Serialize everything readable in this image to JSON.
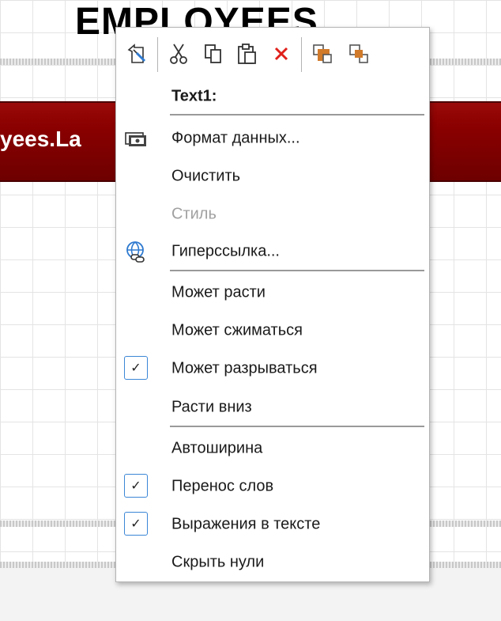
{
  "canvas": {
    "title": "EMPLOYEES",
    "header_field": "yees.La"
  },
  "toolbar": {
    "buttons": [
      {
        "name": "edit-icon"
      },
      {
        "name": "cut-icon"
      },
      {
        "name": "copy-icon"
      },
      {
        "name": "paste-icon"
      },
      {
        "name": "delete-icon",
        "color": "#e0201b"
      },
      {
        "name": "bring-to-front-icon",
        "color": "#d07a2a"
      },
      {
        "name": "send-to-back-icon",
        "color": "#d07a2a"
      }
    ]
  },
  "menu": {
    "header": "Text1:",
    "items": [
      {
        "label": "Формат данных...",
        "icon": "data-format-icon",
        "enabled": true
      },
      {
        "label": "Очистить",
        "enabled": true
      },
      {
        "label": "Стиль",
        "enabled": false
      },
      {
        "label": "Гиперссылка...",
        "icon": "hyperlink-icon",
        "enabled": true
      },
      {
        "label": "Может расти",
        "enabled": true
      },
      {
        "label": "Может сжиматься",
        "enabled": true
      },
      {
        "label": "Может разрываться",
        "checked": true
      },
      {
        "label": "Расти вниз",
        "enabled": true
      },
      {
        "label": "Автоширина",
        "enabled": true
      },
      {
        "label": "Перенос слов",
        "checked": true
      },
      {
        "label": "Выражения в тексте",
        "checked": true
      },
      {
        "label": "Скрыть нули",
        "enabled": true
      }
    ],
    "check_mark": "✓",
    "accent_color": "#3b86d6"
  }
}
